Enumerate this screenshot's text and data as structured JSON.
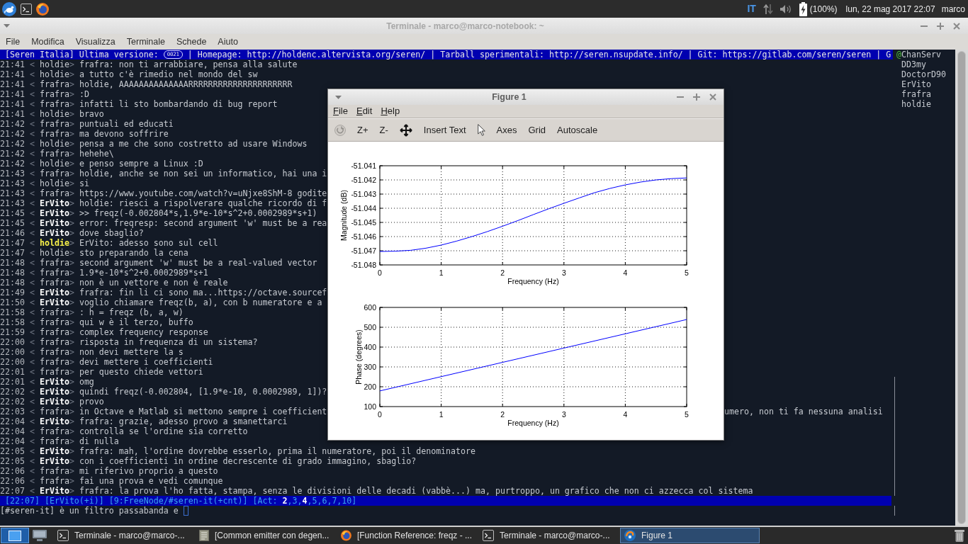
{
  "top_panel": {
    "keyboard_layout": "IT",
    "battery": "(100%)",
    "clock": "lun, 22 mag 2017 22:07",
    "user": "marco"
  },
  "terminal_window": {
    "title": "Terminale - marco@marco-notebook: ~",
    "menu": [
      "File",
      "Modifica",
      "Visualizza",
      "Terminale",
      "Schede",
      "Aiuto"
    ],
    "topic": {
      "before": "[Seren Italia] Ultima versione:",
      "version": "0021",
      "after": "| Homepage: http://holdenc.altervista.org/seren/ | Tarball sperimentali: http://seren.nsupdate.info/ | Git: https://gitlab.com/seren/seren | G"
    },
    "messages": [
      {
        "time": "21:41",
        "open": "<",
        "nick": "holdie",
        "close": ">",
        "kind": "normal",
        "text": "frafra: non ti arrabbiare, pensa alla salute"
      },
      {
        "time": "21:41",
        "open": "<",
        "nick": "holdie",
        "close": ">",
        "kind": "normal",
        "text": "a tutto c'è rimedio nel mondo del sw"
      },
      {
        "time": "21:41",
        "open": "<",
        "nick": "frafra",
        "close": ">",
        "kind": "normal",
        "text": "holdie, AAAAAAAAAAAAAARRRRRRRRRRRRRRRRRRRRR"
      },
      {
        "time": "21:41",
        "open": "<",
        "nick": "frafra",
        "close": ">",
        "kind": "normal",
        "text": ":D"
      },
      {
        "time": "21:41",
        "open": "<",
        "nick": "frafra",
        "close": ">",
        "kind": "normal",
        "text": "infatti li sto bombardando di bug report"
      },
      {
        "time": "21:41",
        "open": "<",
        "nick": "holdie",
        "close": ">",
        "kind": "normal",
        "text": "bravo"
      },
      {
        "time": "21:42",
        "open": "<",
        "nick": "frafra",
        "close": ">",
        "kind": "normal",
        "text": "puntuali ed educati"
      },
      {
        "time": "21:42",
        "open": "<",
        "nick": "frafra",
        "close": ">",
        "kind": "normal",
        "text": "ma devono soffrire"
      },
      {
        "time": "21:42",
        "open": "<",
        "nick": "holdie",
        "close": ">",
        "kind": "normal",
        "text": "pensa a me che sono costretto ad usare Windows"
      },
      {
        "time": "21:42",
        "open": "<",
        "nick": "frafra",
        "close": ">",
        "kind": "normal",
        "text": "hehehe\\"
      },
      {
        "time": "21:42",
        "open": "<",
        "nick": "holdie",
        "close": ">",
        "kind": "normal",
        "text": "e penso sempre a Linux :D"
      },
      {
        "time": "21:43",
        "open": "<",
        "nick": "frafra",
        "close": ">",
        "kind": "normal",
        "text": "holdie, anche se non sei un informatico, hai una i"
      },
      {
        "time": "21:43",
        "open": "<",
        "nick": "holdie",
        "close": ">",
        "kind": "normal",
        "text": "si"
      },
      {
        "time": "21:43",
        "open": "<",
        "nick": "frafra",
        "close": ">",
        "kind": "normal",
        "text": "https://www.youtube.com/watch?v=uNjxe8ShM-8 godite"
      },
      {
        "time": "21:43",
        "open": "<",
        "nick": "ErVito",
        "close": ">",
        "kind": "own",
        "text": "holdie: riesci a rispolverare qualche ricordo di f"
      },
      {
        "time": "21:45",
        "open": "<",
        "nick": "ErVito",
        "close": ">",
        "kind": "own",
        "text": ">> freqz(-0.002804*s,1.9*e-10*s^2+0.0002989*s+1)"
      },
      {
        "time": "21:45",
        "open": "<",
        "nick": "ErVito",
        "close": ">",
        "kind": "own",
        "text": "error: freqresp: second argument 'w' must be a rea"
      },
      {
        "time": "21:46",
        "open": "<",
        "nick": "ErVito",
        "close": ">",
        "kind": "own",
        "text": "dove sbaglio?"
      },
      {
        "time": "21:47",
        "open": "<",
        "nick": "holdie",
        "close": ">",
        "kind": "hilight",
        "text": "ErVito: adesso sono sul cell"
      },
      {
        "time": "21:47",
        "open": "<",
        "nick": "holdie",
        "close": ">",
        "kind": "normal",
        "text": "sto preparando la cena"
      },
      {
        "time": "21:48",
        "open": "<",
        "nick": "frafra",
        "close": ">",
        "kind": "normal",
        "text": "second argument 'w' must be a real-valued vector"
      },
      {
        "time": "21:48",
        "open": "<",
        "nick": "frafra",
        "close": ">",
        "kind": "normal",
        "text": "1.9*e-10*s^2+0.0002989*s+1"
      },
      {
        "time": "21:48",
        "open": "<",
        "nick": "frafra",
        "close": ">",
        "kind": "normal",
        "text": "non è un vettore e non è reale"
      },
      {
        "time": "21:49",
        "open": "<",
        "nick": "ErVito",
        "close": ">",
        "kind": "own",
        "text": "frafra: fin li ci sono ma...https://octave.sourcef"
      },
      {
        "time": "21:50",
        "open": "<",
        "nick": "ErVito",
        "close": ">",
        "kind": "own",
        "text": "voglio chiamare freqz(b, a), con b numeratore e a"
      },
      {
        "time": "21:58",
        "open": "<",
        "nick": "frafra",
        "close": ">",
        "kind": "normal",
        "text": ": h = freqz (b, a, w)"
      },
      {
        "time": "21:58",
        "open": "<",
        "nick": "frafra",
        "close": ">",
        "kind": "normal",
        "text": "qui w è il terzo, buffo"
      },
      {
        "time": "21:59",
        "open": "<",
        "nick": "frafra",
        "close": ">",
        "kind": "normal",
        "text": "complex frequency response"
      },
      {
        "time": "22:00",
        "open": "<",
        "nick": "frafra",
        "close": ">",
        "kind": "normal",
        "text": "risposta in frequenza di un sistema?"
      },
      {
        "time": "22:00",
        "open": "<",
        "nick": "frafra",
        "close": ">",
        "kind": "normal",
        "text": "non devi mettere la s"
      },
      {
        "time": "22:00",
        "open": "<",
        "nick": "frafra",
        "close": ">",
        "kind": "normal",
        "text": "devi mettere i coefficienti"
      },
      {
        "time": "22:01",
        "open": "<",
        "nick": "frafra",
        "close": ">",
        "kind": "normal",
        "text": "per questo chiede vettori"
      },
      {
        "time": "22:01",
        "open": "<",
        "nick": "ErVito",
        "close": ">",
        "kind": "own",
        "text": "omg"
      },
      {
        "time": "22:02",
        "open": "<",
        "nick": "ErVito",
        "close": ">",
        "kind": "own",
        "text": "quindi freqz(-0.002804, [1.9*e-10, 0.0002989, 1])?"
      },
      {
        "time": "22:02",
        "open": "<",
        "nick": "ErVito",
        "close": ">",
        "kind": "own",
        "text": "provo"
      },
      {
        "time": "22:03",
        "open": "<",
        "nick": "frafra",
        "close": ">",
        "kind": "normal",
        "text": "in Octave e Matlab si mettono sempre i coefficient",
        "text_right": "umero, non ti fa nessuna analisi"
      },
      {
        "time": "22:04",
        "open": "<",
        "nick": "ErVito",
        "close": ">",
        "kind": "own",
        "text": "frafra: grazie, adesso provo a smanettarci"
      },
      {
        "time": "22:04",
        "open": "<",
        "nick": "frafra",
        "close": ">",
        "kind": "normal",
        "text": "controlla se l'ordine sia corretto"
      },
      {
        "time": "22:04",
        "open": "<",
        "nick": "frafra",
        "close": ">",
        "kind": "normal",
        "text": "di nulla"
      },
      {
        "time": "22:05",
        "open": "<",
        "nick": "ErVito",
        "close": ">",
        "kind": "own",
        "text": "frafra: mah, l'ordine dovrebbe esserlo, prima il numeratore, poi il denominatore"
      },
      {
        "time": "22:05",
        "open": "<",
        "nick": "ErVito",
        "close": ">",
        "kind": "own",
        "text": "con i coefficienti in ordine decrescente di grado immagino, sbaglio?"
      },
      {
        "time": "22:06",
        "open": "<",
        "nick": "frafra",
        "close": ">",
        "kind": "normal",
        "text": "mi riferivo proprio a questo"
      },
      {
        "time": "22:06",
        "open": "<",
        "nick": "frafra",
        "close": ">",
        "kind": "normal",
        "text": "fai una prova e vedi comunque"
      },
      {
        "time": "22:07",
        "open": "<",
        "nick": "ErVito",
        "close": ">",
        "kind": "own",
        "text": "frafra: la prova l'ho fatta, stampa, senza le divisioni delle decadi (vabbè...) ma, purtroppo, un grafico che non ci azzecca col sistema"
      }
    ],
    "status_bar": [
      "[22:07]",
      "[ErVito(+i)]",
      "[9:FreeNode/#seren-it(+cnt)]",
      "[Act: **2**,3,**4**,5,6,7,10]"
    ],
    "input": {
      "prompt": "[#seren-it]",
      "value": "è un filtro passabanda e"
    },
    "nicklist": [
      {
        "mode": "@",
        "name": "ChanServ"
      },
      {
        "name": "DD3my"
      },
      {
        "name": "DoctorD90"
      },
      {
        "name": "ErVito"
      },
      {
        "name": "frafra"
      },
      {
        "name": "holdie"
      }
    ]
  },
  "figure_window": {
    "title": "Figure 1",
    "menu": [
      "File",
      "Edit",
      "Help"
    ],
    "toolbar": [
      {
        "kind": "rotate",
        "disabled": true
      },
      {
        "kind": "text",
        "label": "Z+",
        "disabled": false
      },
      {
        "kind": "text",
        "label": "Z-",
        "disabled": false
      },
      {
        "kind": "pan",
        "disabled": false
      },
      {
        "kind": "text",
        "label": "Insert Text",
        "disabled": false
      },
      {
        "kind": "select",
        "disabled": false
      },
      {
        "kind": "text",
        "label": "Axes",
        "disabled": false
      },
      {
        "kind": "text",
        "label": "Grid",
        "disabled": false
      },
      {
        "kind": "text",
        "label": "Autoscale",
        "disabled": false
      }
    ],
    "chart_data": [
      {
        "type": "line",
        "xlabel": "Frequency (Hz)",
        "ylabel": "Magnitude (dB)",
        "x": [
          0,
          0.25,
          0.5,
          0.75,
          1,
          1.25,
          1.5,
          1.75,
          2,
          2.25,
          2.5,
          2.75,
          3,
          3.25,
          3.5,
          3.75,
          4,
          4.25,
          4.5,
          4.75,
          5
        ],
        "values": [
          -51.04705,
          -51.04703,
          -51.04697,
          -51.04682,
          -51.0466,
          -51.04632,
          -51.046,
          -51.04565,
          -51.04527,
          -51.04487,
          -51.04445,
          -51.04404,
          -51.04365,
          -51.04327,
          -51.0429,
          -51.0426,
          -51.04235,
          -51.04215,
          -51.042,
          -51.04191,
          -51.04186
        ],
        "color": "#0000ff",
        "xlim": [
          0,
          5
        ],
        "ylim": [
          -51.048,
          -51.041
        ],
        "xticks": [
          0,
          1,
          2,
          3,
          4,
          5
        ],
        "yticks": [
          -51.048,
          -51.047,
          -51.046,
          -51.045,
          -51.044,
          -51.043,
          -51.042,
          -51.041
        ],
        "grid": true
      },
      {
        "type": "line",
        "xlabel": "Frequency (Hz)",
        "ylabel": "Phase (degrees)",
        "x": [
          0,
          1,
          2,
          3,
          4,
          5
        ],
        "values": [
          179,
          251,
          323,
          395,
          467,
          539
        ],
        "color": "#0000ff",
        "xlim": [
          0,
          5
        ],
        "ylim": [
          100,
          600
        ],
        "xticks": [
          0,
          1,
          2,
          3,
          4,
          5
        ],
        "yticks": [
          100,
          200,
          300,
          400,
          500,
          600
        ],
        "grid": true
      }
    ]
  },
  "taskbar": {
    "tasks": [
      {
        "kind": "terminal",
        "label": "Terminale - marco@marco-...",
        "selected": false
      },
      {
        "kind": "document",
        "label": "[Common emitter con degen...",
        "selected": false
      },
      {
        "kind": "browser",
        "label": "[Function Reference: freqz - ...",
        "selected": false
      },
      {
        "kind": "terminal",
        "label": "Terminale - marco@marco-...",
        "selected": false
      },
      {
        "kind": "figure",
        "label": "Figure 1",
        "selected": true
      }
    ]
  }
}
